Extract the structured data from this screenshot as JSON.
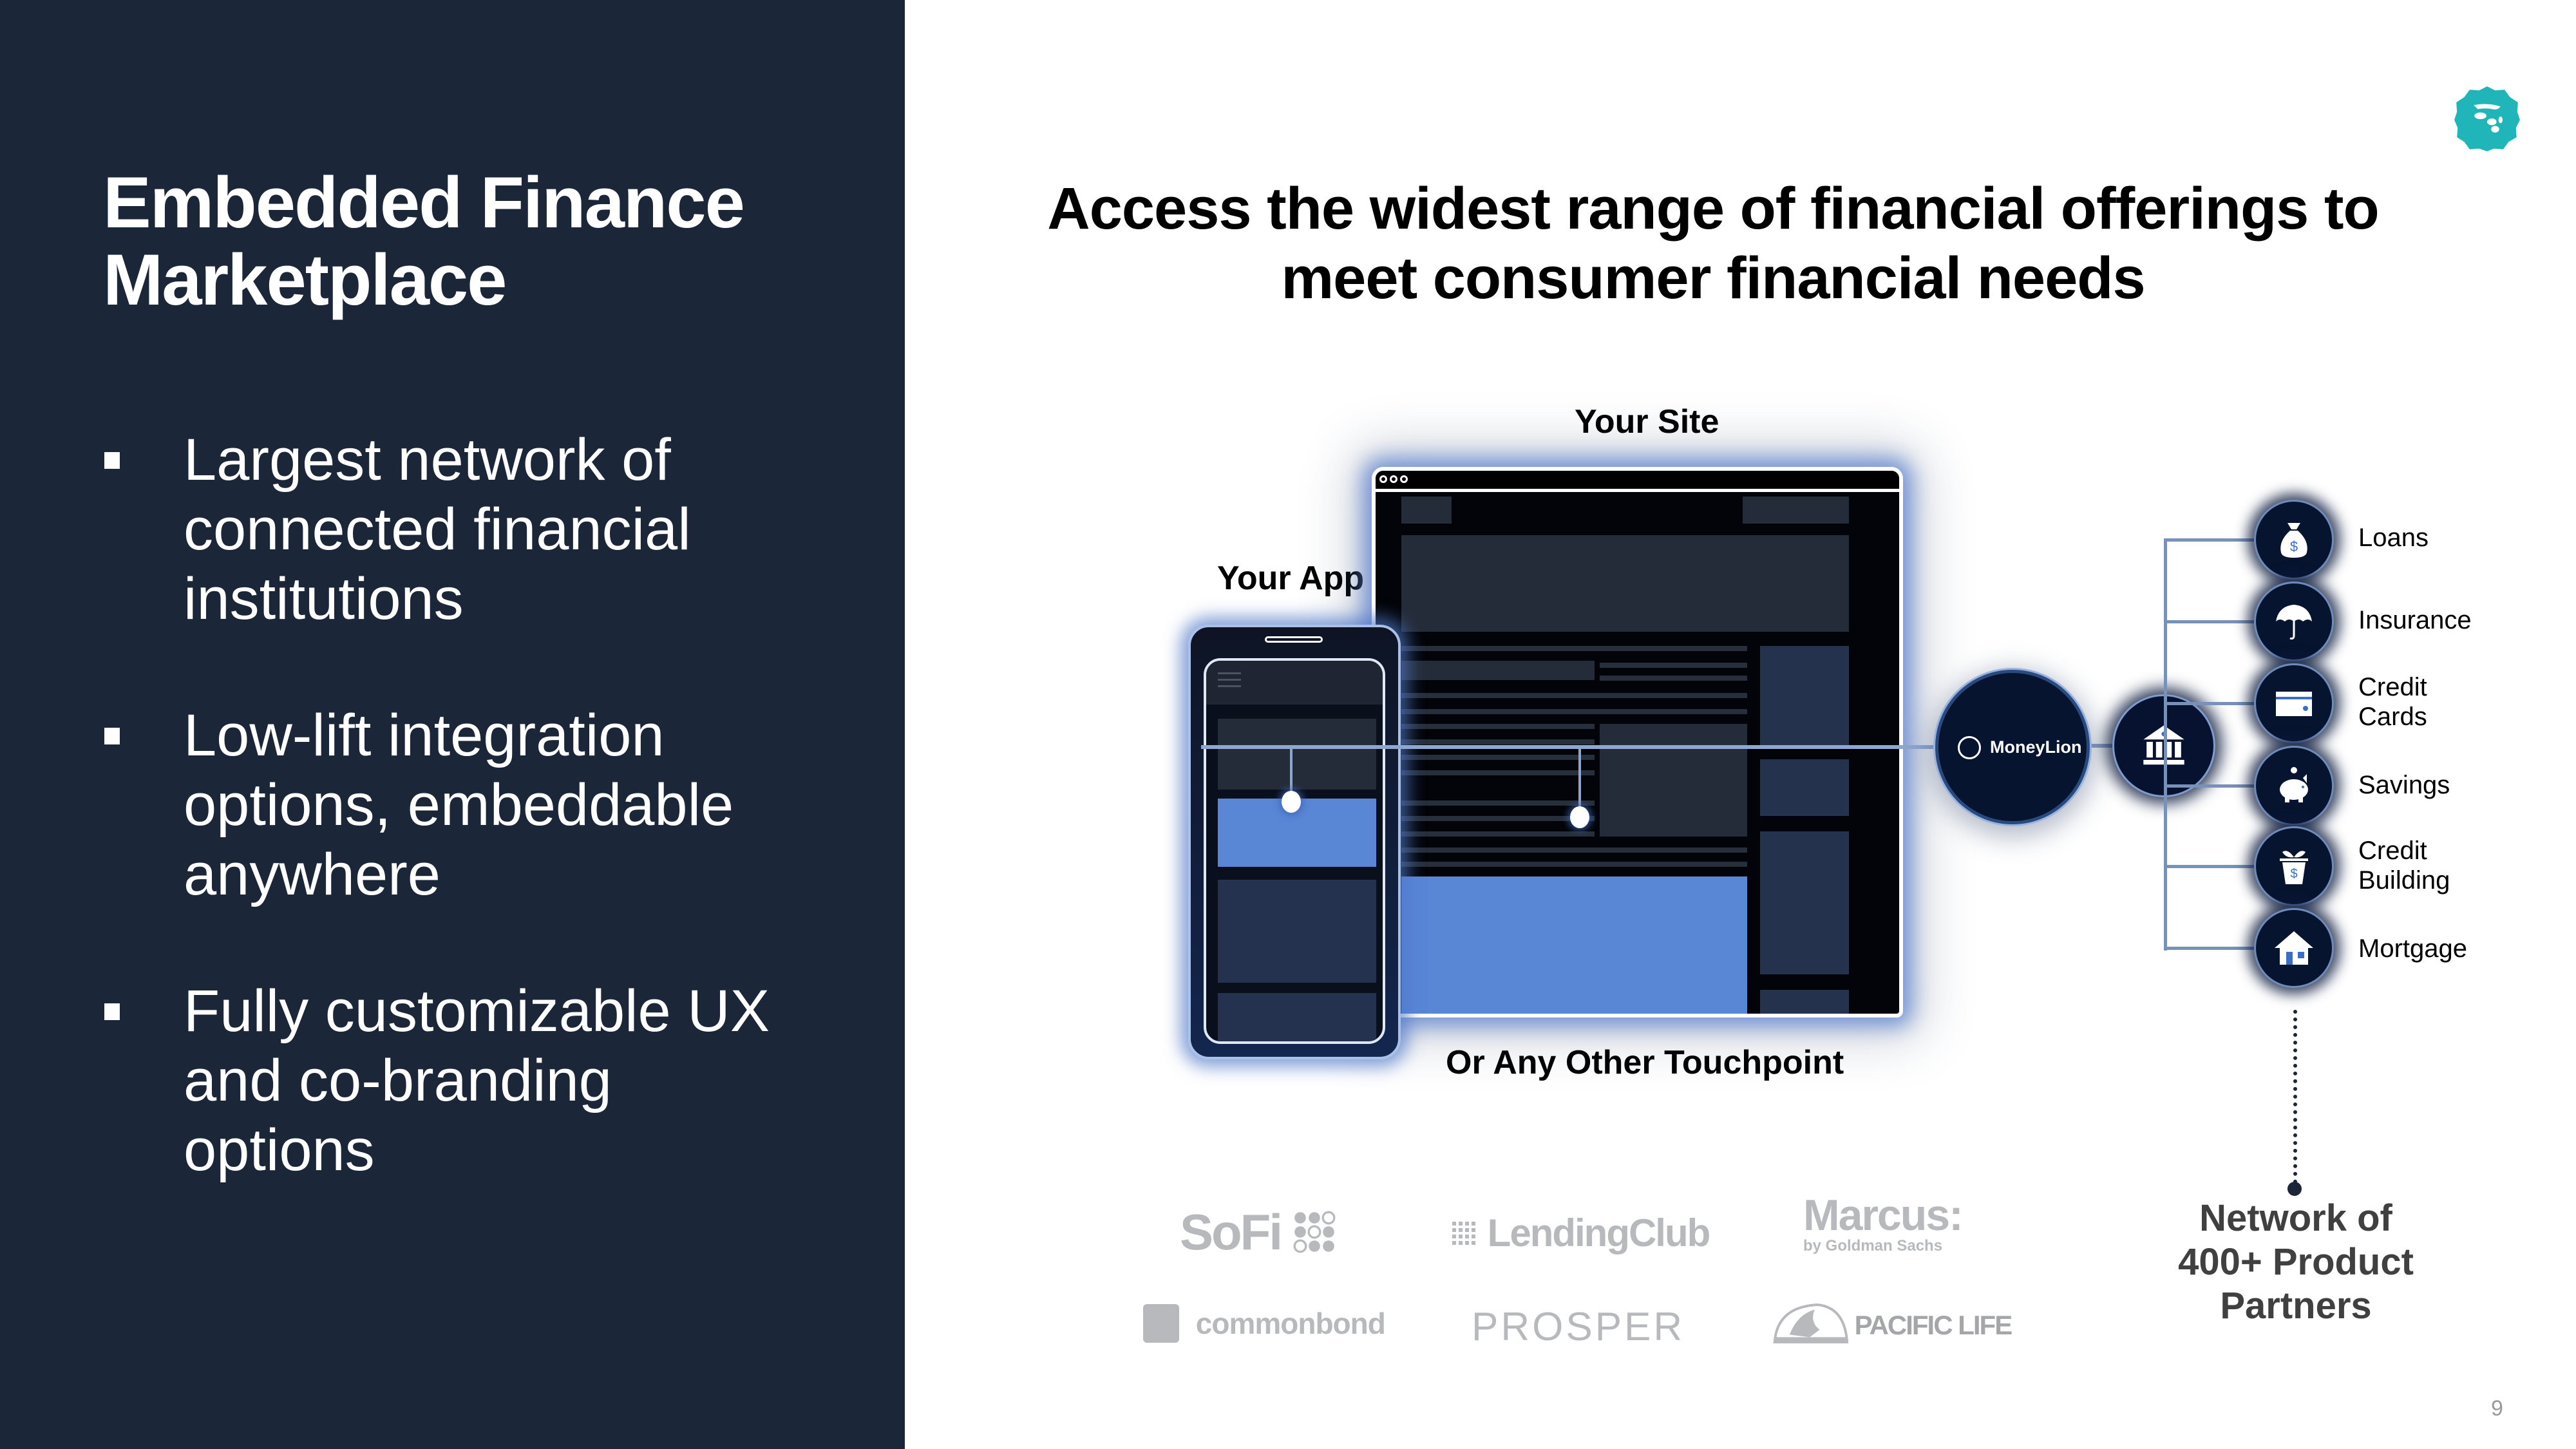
{
  "left": {
    "title_line1": "Embedded Finance",
    "title_line2": "Marketplace",
    "bullets": [
      [
        "Largest network of",
        "connected financial",
        "institutions"
      ],
      [
        "Low-lift integration",
        "options, embeddable",
        "anywhere"
      ],
      [
        "Fully customizable UX",
        "and co-branding",
        "options"
      ]
    ]
  },
  "header": {
    "title_line1": "Access the widest range of financial offerings to",
    "title_line2": "meet consumer financial needs",
    "logo_icon": "moneylion-lion-icon",
    "accent_color": "#1fb5b9"
  },
  "diagram": {
    "your_site_label": "Your Site",
    "your_app_label": "Your App",
    "touchpoint_label": "Or Any Other Touchpoint",
    "hub_label": "MoneyLion",
    "bank_icon": "bank-icon",
    "highlight_color": "#5a86d6",
    "products": [
      {
        "label_line1": "Loans",
        "label_line2": "",
        "icon": "money-bag-icon"
      },
      {
        "label_line1": "Insurance",
        "label_line2": "",
        "icon": "umbrella-icon"
      },
      {
        "label_line1": "Credit",
        "label_line2": "Cards",
        "icon": "credit-card-icon"
      },
      {
        "label_line1": "Savings",
        "label_line2": "",
        "icon": "piggy-bank-icon"
      },
      {
        "label_line1": "Credit",
        "label_line2": "Building",
        "icon": "plant-pot-icon"
      },
      {
        "label_line1": "Mortgage",
        "label_line2": "",
        "icon": "house-icon"
      }
    ],
    "network_line1": "Network of",
    "network_line2": "400+ Product",
    "network_line3": "Partners"
  },
  "partners": {
    "sofi": "SoFi",
    "lendingclub": "LendingClub",
    "marcus": "Marcus:",
    "marcus_sub": "by Goldman Sachs",
    "commonbond": "commonbond",
    "prosper": "PROSPER",
    "pacificlife": "PACIFIC LIFE"
  },
  "footer": {
    "page_number": "9"
  }
}
